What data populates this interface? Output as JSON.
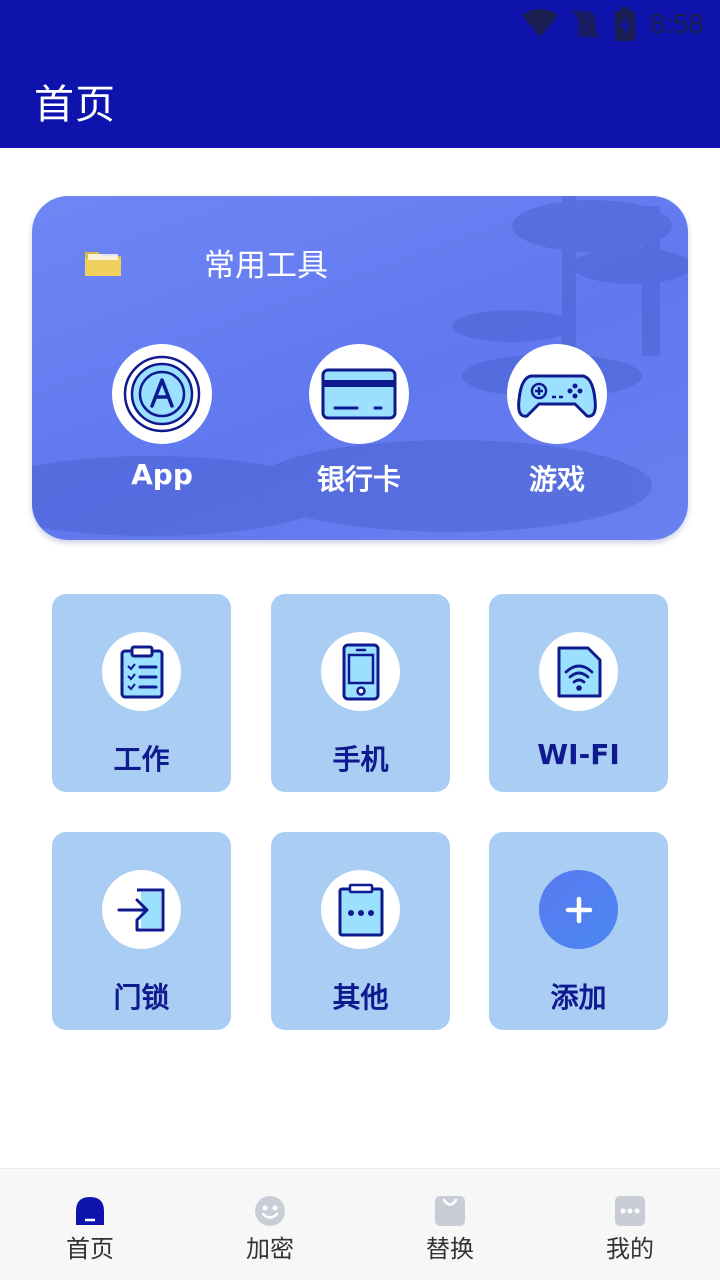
{
  "status_bar": {
    "time": "8:58"
  },
  "app_bar": {
    "title": "首页"
  },
  "tools_card": {
    "title": "常用工具",
    "items": [
      {
        "label": "App",
        "icon": "app-store-icon"
      },
      {
        "label": "银行卡",
        "icon": "bank-card-icon"
      },
      {
        "label": "游戏",
        "icon": "gamepad-icon"
      }
    ]
  },
  "grid": [
    {
      "label": "工作",
      "icon": "clipboard-icon"
    },
    {
      "label": "手机",
      "icon": "phone-icon"
    },
    {
      "label": "WI-FI",
      "icon": "wifi-card-icon"
    },
    {
      "label": "门锁",
      "icon": "door-login-icon"
    },
    {
      "label": "其他",
      "icon": "more-clipboard-icon"
    },
    {
      "label": "添加",
      "icon": "plus-icon"
    }
  ],
  "bottom_nav": [
    {
      "label": "首页",
      "icon": "home-icon"
    },
    {
      "label": "加密",
      "icon": "smile-icon"
    },
    {
      "label": "替换",
      "icon": "bag-icon"
    },
    {
      "label": "我的",
      "icon": "chat-dots-icon"
    }
  ],
  "colors": {
    "primary": "#0e14ab",
    "card_gradient": "#6b82f3",
    "tile": "#a9cdf3",
    "tile_text": "#0f1a8f"
  }
}
